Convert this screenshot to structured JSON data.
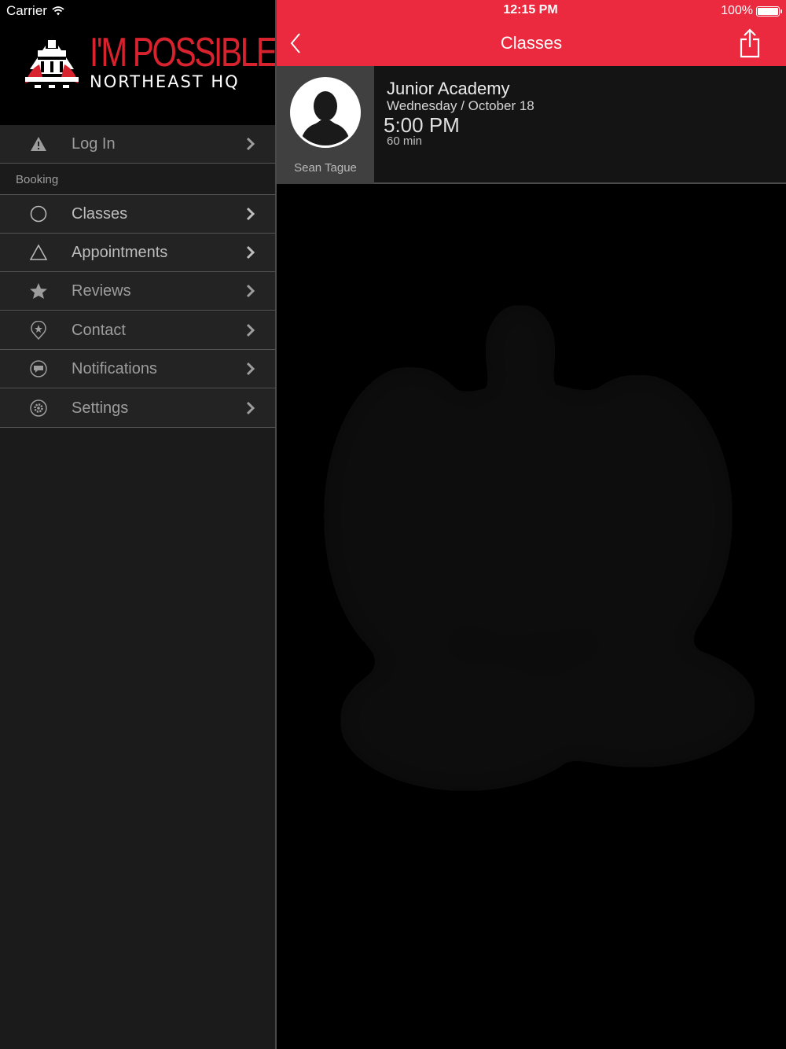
{
  "status_bar": {
    "carrier": "Carrier",
    "time": "12:15 PM",
    "battery": "100%",
    "battery_level": 1.0,
    "icons": [
      "wifi-icon",
      "battery-icon"
    ]
  },
  "sidebar": {
    "logo": {
      "line1": "I'M POSSIBLE",
      "line2": "NORTHEAST HQ"
    },
    "login": {
      "label": "Log In",
      "icon": "warning-icon"
    },
    "section_label": "Booking",
    "items": [
      {
        "label": "Classes",
        "icon": "circle-icon"
      },
      {
        "label": "Appointments",
        "icon": "triangle-icon"
      },
      {
        "label": "Reviews",
        "icon": "star-icon"
      },
      {
        "label": "Contact",
        "icon": "location-pin-icon"
      },
      {
        "label": "Notifications",
        "icon": "chat-bubble-icon"
      },
      {
        "label": "Settings",
        "icon": "gear-icon"
      }
    ]
  },
  "navbar": {
    "title": "Classes",
    "back_icon": "chevron-left-icon",
    "share_icon": "share-icon"
  },
  "classes": [
    {
      "title": "Junior Academy",
      "date": "Wednesday / October 18",
      "time": "5:00 PM",
      "duration": "60 min",
      "instructor": "Sean Tague"
    }
  ],
  "colors": {
    "accent": "#eb2a3f",
    "logo_red": "#d8232f",
    "sidebar_bg": "#1b1b1b",
    "row_bg": "#232323"
  }
}
